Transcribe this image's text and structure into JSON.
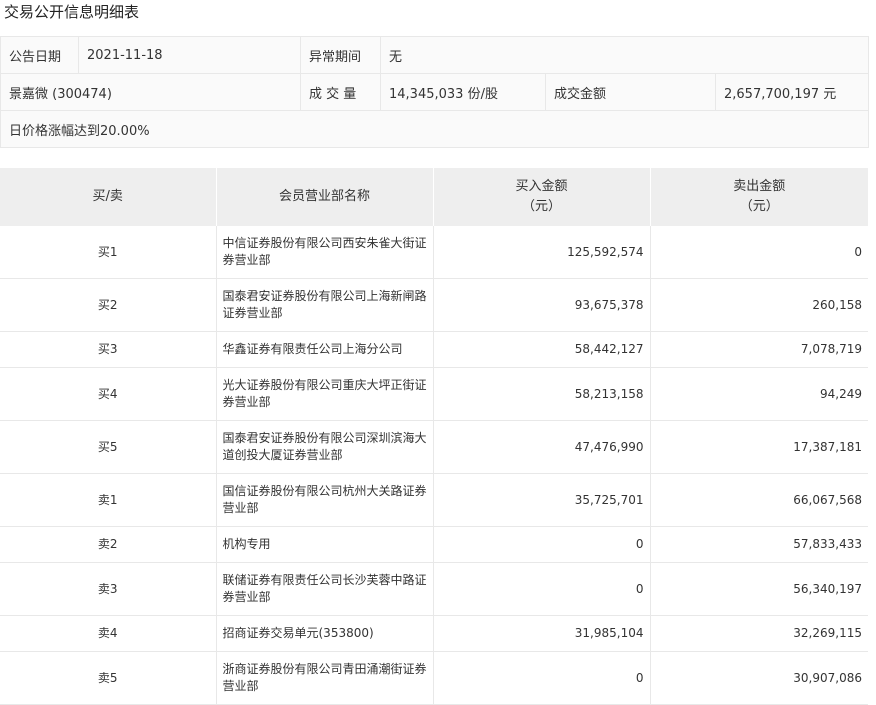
{
  "title": "交易公开信息明细表",
  "info": {
    "announce_date_label": "公告日期",
    "announce_date": "2021-11-18",
    "abnormal_period_label": "异常期间",
    "abnormal_period": "无",
    "stock": "景嘉微 (300474)",
    "volume_label": "成 交 量",
    "volume": "14,345,033 份/股",
    "amount_label": "成交金额",
    "amount": "2,657,700,197 元",
    "reason": "日价格涨幅达到20.00%"
  },
  "table": {
    "headers": {
      "side": "买/卖",
      "name": "会员营业部名称",
      "buy_line1": "买入金额",
      "buy_line2": "（元）",
      "sell_line1": "卖出金额",
      "sell_line2": "（元）"
    },
    "rows": [
      {
        "side": "买1",
        "name": "中信证券股份有限公司西安朱雀大街证券营业部",
        "buy": "125,592,574",
        "sell": "0"
      },
      {
        "side": "买2",
        "name": "国泰君安证券股份有限公司上海新闸路证券营业部",
        "buy": "93,675,378",
        "sell": "260,158"
      },
      {
        "side": "买3",
        "name": "华鑫证券有限责任公司上海分公司",
        "buy": "58,442,127",
        "sell": "7,078,719"
      },
      {
        "side": "买4",
        "name": "光大证券股份有限公司重庆大坪正街证券营业部",
        "buy": "58,213,158",
        "sell": "94,249"
      },
      {
        "side": "买5",
        "name": "国泰君安证券股份有限公司深圳滨海大道创投大厦证券营业部",
        "buy": "47,476,990",
        "sell": "17,387,181"
      },
      {
        "side": "卖1",
        "name": "国信证券股份有限公司杭州大关路证券营业部",
        "buy": "35,725,701",
        "sell": "66,067,568"
      },
      {
        "side": "卖2",
        "name": "机构专用",
        "buy": "0",
        "sell": "57,833,433"
      },
      {
        "side": "卖3",
        "name": "联储证券有限责任公司长沙芙蓉中路证券营业部",
        "buy": "0",
        "sell": "56,340,197"
      },
      {
        "side": "卖4",
        "name": "招商证券交易单元(353800)",
        "buy": "31,985,104",
        "sell": "32,269,115"
      },
      {
        "side": "卖5",
        "name": "浙商证券股份有限公司青田涌潮街证券营业部",
        "buy": "0",
        "sell": "30,907,086"
      }
    ]
  }
}
